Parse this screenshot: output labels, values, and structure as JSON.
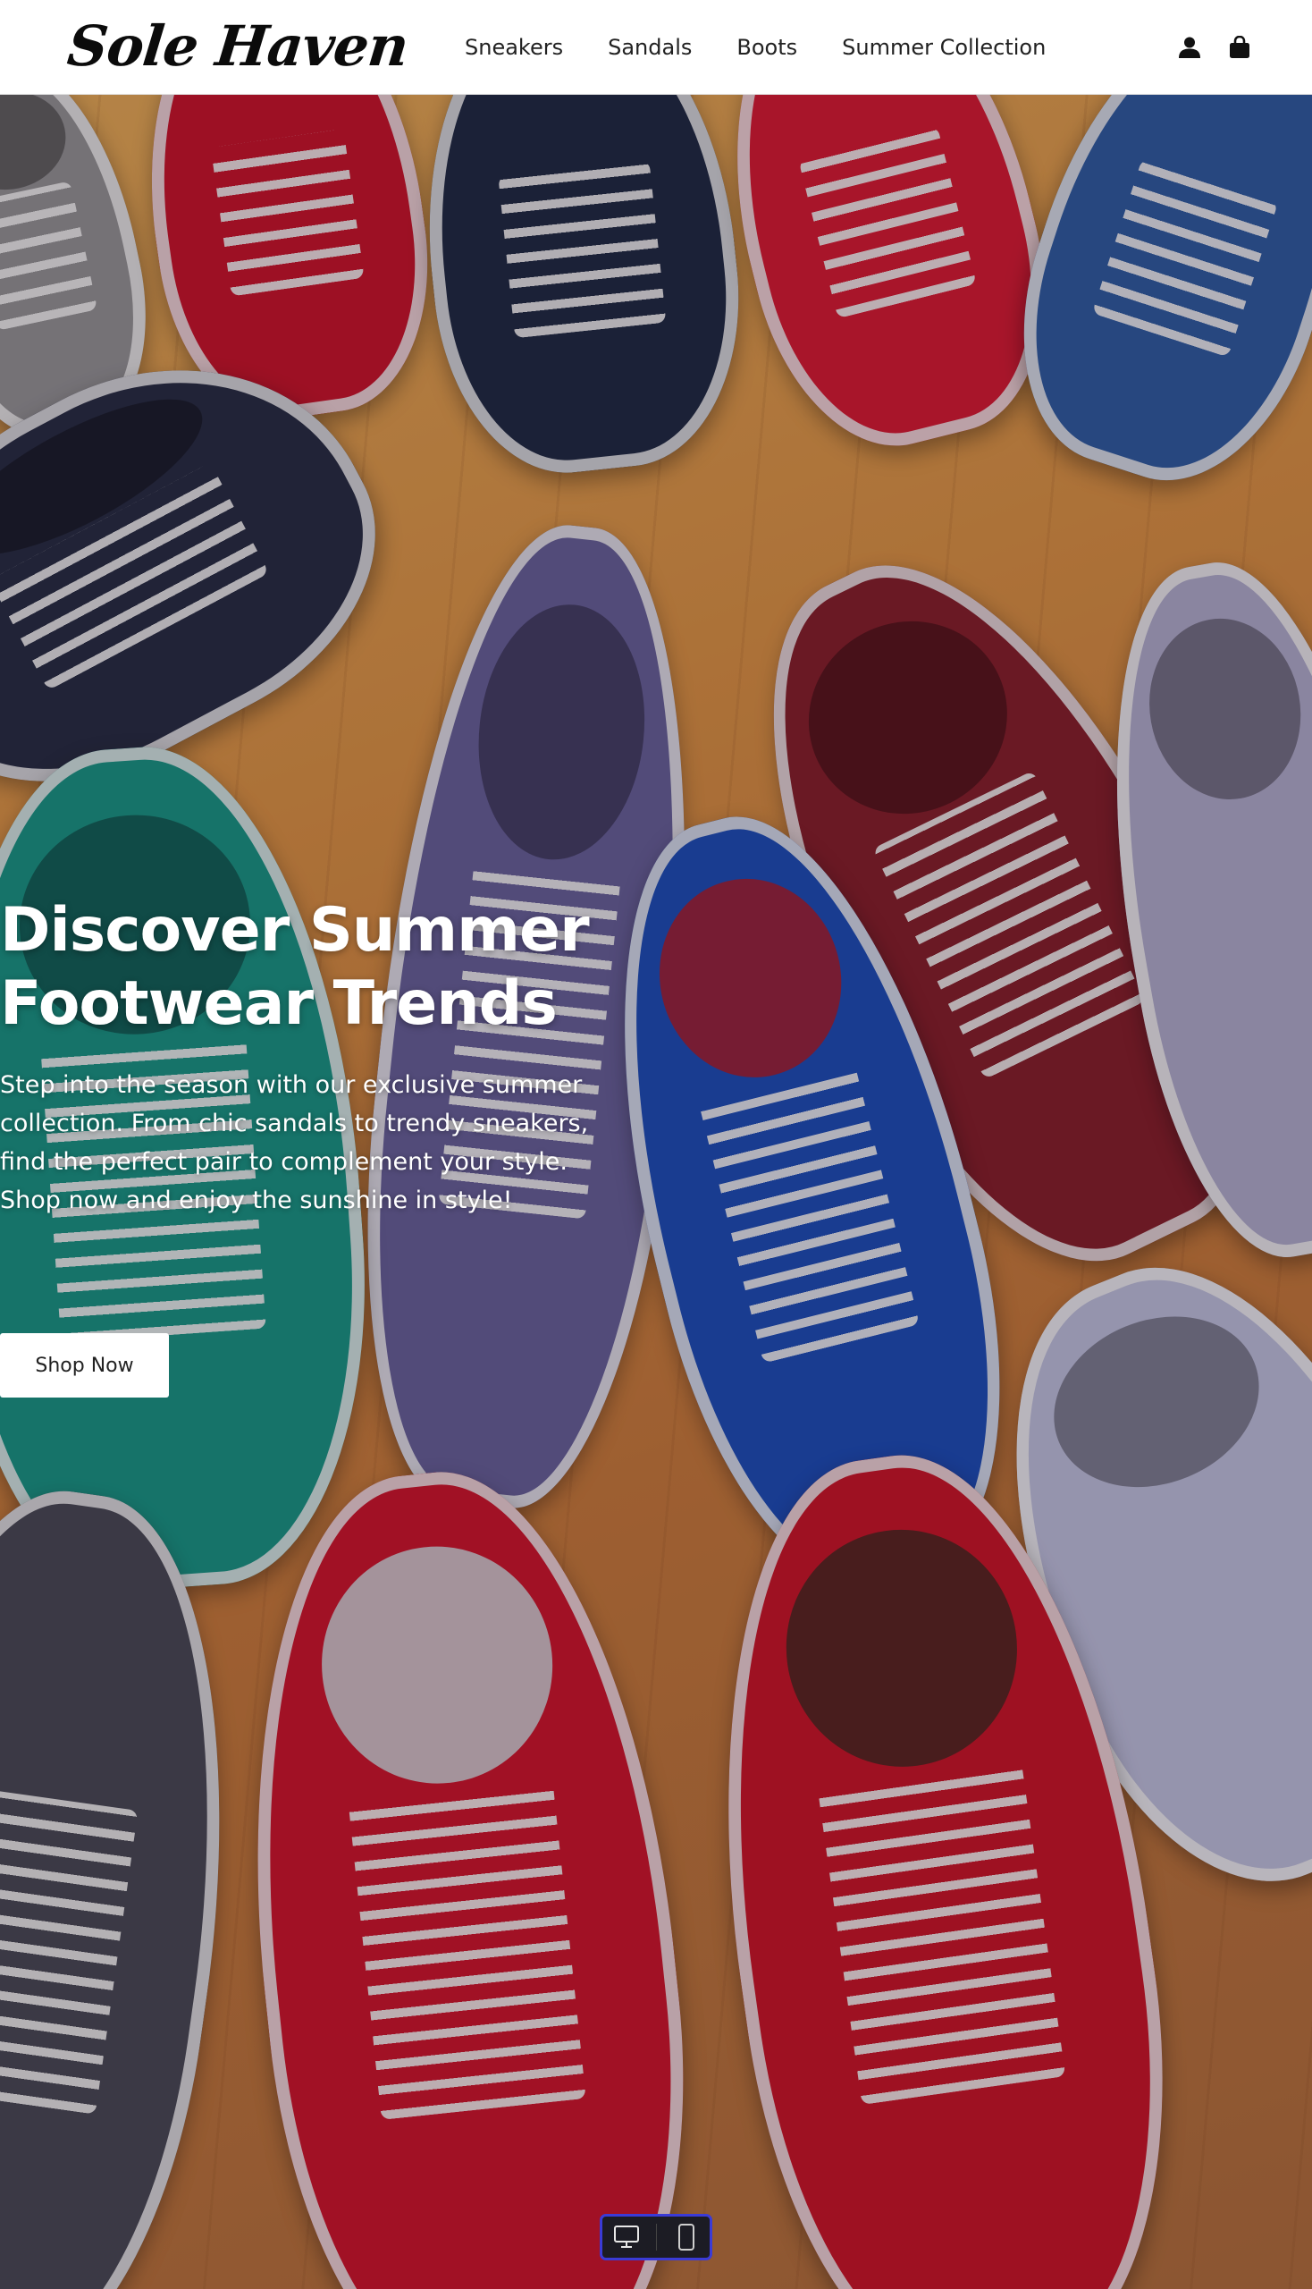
{
  "header": {
    "logo": "Sole Haven",
    "nav": [
      {
        "label": "Sneakers"
      },
      {
        "label": "Sandals"
      },
      {
        "label": "Boots"
      },
      {
        "label": "Summer Collection"
      }
    ],
    "icons": [
      "user-icon",
      "shopping-bag-icon"
    ]
  },
  "hero": {
    "title": "Discover Summer Footwear Trends",
    "description": "Step into the season with our exclusive summer collection. From chic sandals to trendy sneakers, find the perfect pair to complement your style. Shop now and enjoy the sunshine in style!",
    "cta_label": "Shop Now",
    "background_image": "colorful sneakers on a wooden floor"
  },
  "device_toggle": {
    "icons": [
      "desktop-icon",
      "mobile-icon"
    ]
  },
  "colors": {
    "header_bg": "#ffffff",
    "text_dark": "#222222",
    "hero_text": "#ffffff",
    "toggle_border": "#3b3bd6"
  }
}
